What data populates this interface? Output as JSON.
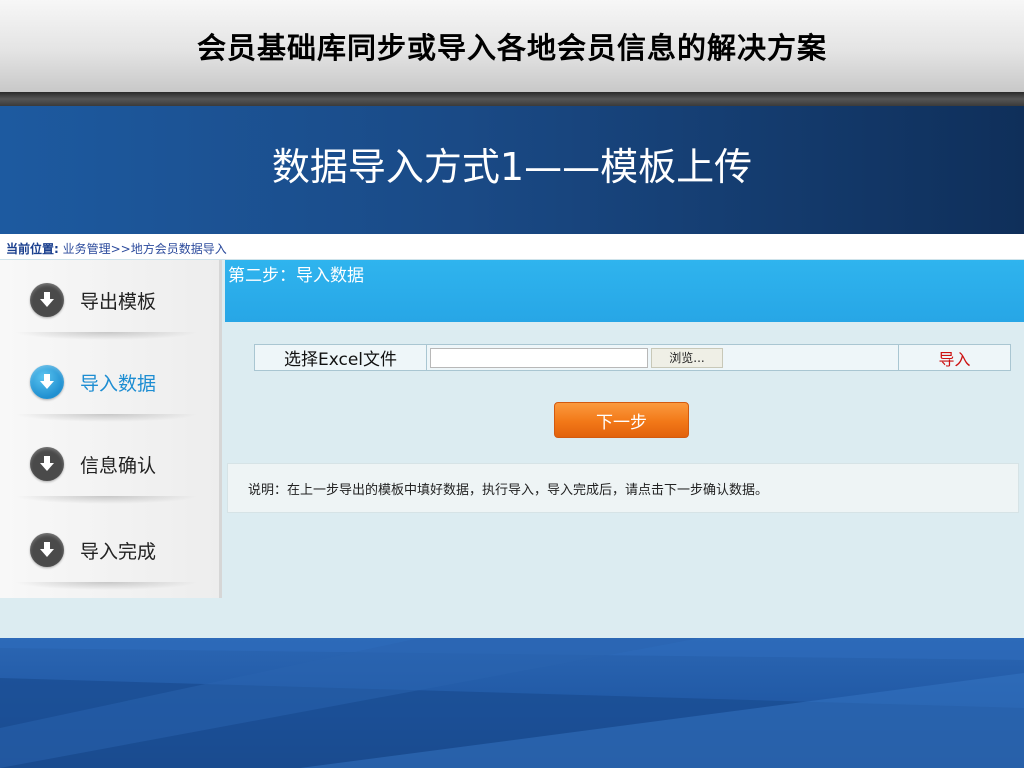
{
  "slide": {
    "title": "会员基础库同步或导入各地会员信息的解决方案",
    "subtitle": "数据导入方式1——模板上传"
  },
  "breadcrumb": {
    "label": "当前位置:",
    "path": " 业务管理>>地方会员数据导入"
  },
  "steps": [
    {
      "label": "导出模板",
      "icon": "download-arrow-icon",
      "active": false
    },
    {
      "label": "导入数据",
      "icon": "download-arrow-icon",
      "active": true
    },
    {
      "label": "信息确认",
      "icon": "download-arrow-icon",
      "active": false
    },
    {
      "label": "导入完成",
      "icon": "download-arrow-icon",
      "active": false
    }
  ],
  "main": {
    "step_title": "第二步：导入数据",
    "upload_label": "选择Excel文件",
    "file_value": "",
    "browse_label": "浏览...",
    "import_label": "导入",
    "next_label": "下一步",
    "note": "说明：在上一步导出的模板中填好数据，执行导入，导入完成后，请点击下一步确认数据。"
  },
  "colors": {
    "header_blue": "#2fb4ee",
    "active_step": "#1d8dd2",
    "next_button": "#f27818",
    "import_link": "#cc1111"
  }
}
